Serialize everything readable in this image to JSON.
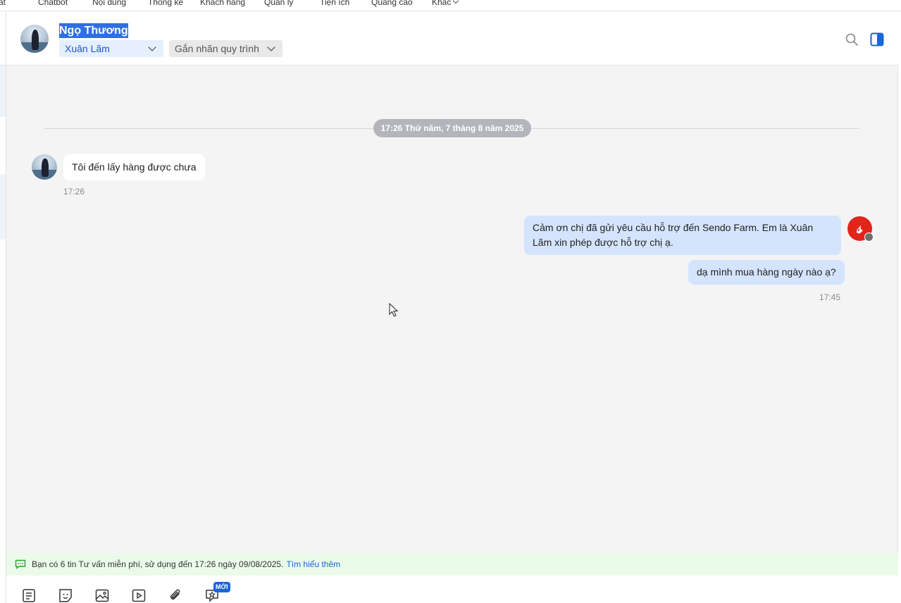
{
  "nav": {
    "items": [
      "at",
      "Chatbot",
      "Nội dung",
      "Thống kê",
      "Khách hàng",
      "Quản lý",
      "Tiện ích",
      "Quảng cáo",
      "Khác"
    ]
  },
  "header": {
    "contact_name": "Ngọ Thương",
    "assignee": "Xuân Lãm",
    "tag_process": "Gắn nhãn quy trình"
  },
  "conversation": {
    "date_divider": "17:26 Thứ năm, 7 tháng 8 năm 2025",
    "incoming": [
      {
        "text": "Tôi đến lấy hàng được chưa",
        "time": "17:26"
      }
    ],
    "outgoing": [
      {
        "text": "Cảm ơn chị đã gửi yêu cầu hỗ trợ đến Sendo Farm. Em là Xuân Lãm xin phép được hỗ trợ chị ạ."
      },
      {
        "text": "dạ mình mua hàng ngày nào ạ?"
      }
    ],
    "outgoing_time": "17:45"
  },
  "notice": {
    "text": "Bạn có 6 tin Tư vấn miễn phí, sử dụng đến 17:26 ngày 09/08/2025.",
    "link": "Tìm hiểu thêm"
  },
  "toolbar": {
    "new_badge": "MỚI"
  },
  "colors": {
    "accent": "#2f6fe4",
    "outgoing_bubble": "#d4e4fd",
    "notice_bg": "#eafbe9",
    "brand_red": "#e1251b"
  }
}
